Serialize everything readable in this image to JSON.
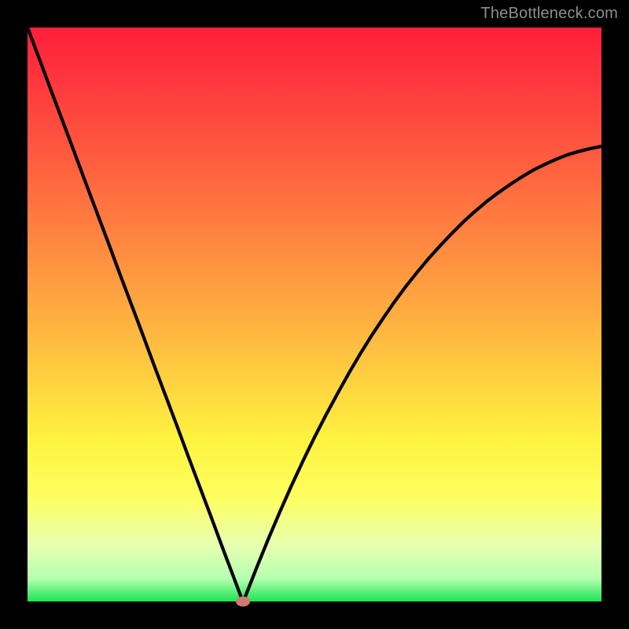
{
  "watermark": "TheBottleneck.com",
  "colors": {
    "curve_stroke": "#000000",
    "marker_fill": "#cf7a6e",
    "frame": "#000000"
  },
  "chart_data": {
    "type": "line",
    "title": "",
    "xlabel": "",
    "ylabel": "",
    "xlim": [
      0,
      1
    ],
    "ylim": [
      0,
      100
    ],
    "x": [
      0.0,
      0.02,
      0.04,
      0.06,
      0.08,
      0.1,
      0.12,
      0.14,
      0.16,
      0.18,
      0.2,
      0.22,
      0.24,
      0.26,
      0.28,
      0.3,
      0.32,
      0.34,
      0.36,
      0.375,
      0.38,
      0.4,
      0.42,
      0.44,
      0.46,
      0.48,
      0.5,
      0.52,
      0.54,
      0.56,
      0.58,
      0.6,
      0.62,
      0.64,
      0.66,
      0.68,
      0.7,
      0.72,
      0.74,
      0.76,
      0.78,
      0.8,
      0.82,
      0.84,
      0.86,
      0.88,
      0.9,
      0.92,
      0.94,
      0.96,
      0.98,
      1.0
    ],
    "values": [
      100.0,
      94.7,
      89.3,
      84.0,
      78.7,
      73.3,
      68.0,
      62.7,
      57.3,
      52.0,
      46.7,
      41.3,
      36.0,
      30.7,
      25.3,
      20.0,
      14.7,
      9.3,
      4.0,
      0.0,
      1.0,
      6.1,
      11.0,
      15.7,
      20.2,
      24.5,
      28.6,
      32.5,
      36.2,
      39.8,
      43.2,
      46.4,
      49.4,
      52.3,
      55.0,
      57.5,
      59.9,
      62.1,
      64.2,
      66.2,
      68.0,
      69.7,
      71.2,
      72.6,
      73.9,
      75.1,
      76.1,
      77.0,
      77.8,
      78.4,
      78.9,
      79.3
    ],
    "optimum": {
      "x": 0.375,
      "y": 0
    },
    "notes": "Black V-shaped curve over a vertical red→green gradient. Minimum (optimum) marked with a small rounded dot near x≈0.375 at the bottom edge. No axis ticks or labels are rendered."
  }
}
